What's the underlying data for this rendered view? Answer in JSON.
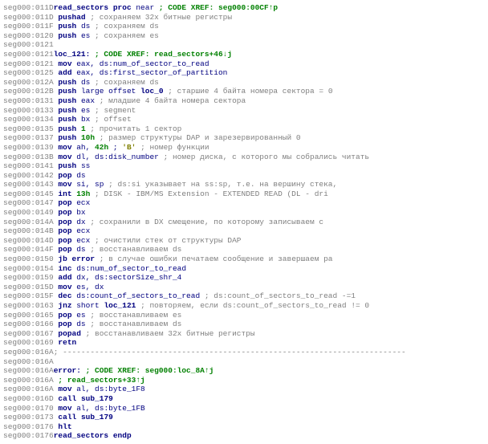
{
  "lines": [
    {
      "addr": "seg000:011D",
      "label": "read_sectors",
      "op1": "proc",
      "op2": "near",
      "xref": "; CODE XREF: seg000:00CF↑p"
    },
    {
      "addr": "seg000:011D",
      "mnemonic": "pushad",
      "comment": "; сохраняем 32x битные регистры"
    },
    {
      "addr": "seg000:011F",
      "mnemonic": "push",
      "args": "ds",
      "comment": "; сохраняем ds"
    },
    {
      "addr": "seg000:0120",
      "mnemonic": "push",
      "args": "es",
      "comment": "; сохраняем es"
    },
    {
      "addr": "seg000:0121"
    },
    {
      "addr": "seg000:0121",
      "label": "loc_121:",
      "xref": "; CODE XREF: read_sectors+46↓j"
    },
    {
      "addr": "seg000:0121",
      "mnemonic": "mov",
      "args": "eax, ds:num_of_sector_to_read"
    },
    {
      "addr": "seg000:0125",
      "mnemonic": "add",
      "args": "eax, ds:first_sector_of_partition"
    },
    {
      "addr": "seg000:012A",
      "mnemonic": "push",
      "args": "ds",
      "comment": "; сохраняем ds"
    },
    {
      "addr": "seg000:012B",
      "mnemonic": "push",
      "args_html": "large offset <span class='label'>loc_0</span>",
      "comment": " ; старшие 4 байта номера сектора = 0"
    },
    {
      "addr": "seg000:0131",
      "mnemonic": "push",
      "args": "eax",
      "comment": "; младшие 4 байта номера сектора"
    },
    {
      "addr": "seg000:0133",
      "mnemonic": "push",
      "args": "es",
      "comment": "; segment"
    },
    {
      "addr": "seg000:0134",
      "mnemonic": "push",
      "args": "bx",
      "comment": "; offset"
    },
    {
      "addr": "seg000:0135",
      "mnemonic": "push",
      "num": "1",
      "comment": "; прочитать 1 сектор"
    },
    {
      "addr": "seg000:0137",
      "mnemonic": "push",
      "numhex": "10h",
      "comment": "; размер структуры DAP и зарезервированный 0"
    },
    {
      "addr": "seg000:0139",
      "mnemonic": "mov",
      "args_html": "ah, <span class='numhex'>42h</span> ; <span class='char'>'B'</span>",
      "comment": "    ; номер функции"
    },
    {
      "addr": "seg000:013B",
      "mnemonic": "mov",
      "args": "dl, ds:disk_number",
      "comment": " ; номер диска, с которого мы собрались читать"
    },
    {
      "addr": "seg000:0141",
      "mnemonic": "push",
      "args": "ss"
    },
    {
      "addr": "seg000:0142",
      "mnemonic": "pop",
      "args": "ds"
    },
    {
      "addr": "seg000:0143",
      "mnemonic": "mov",
      "args": "si, sp",
      "comment": "; ds:si указывает на ss:sp, т.е. на вершину стека,"
    },
    {
      "addr": "seg000:0145",
      "mnemonic": "int",
      "numhex": "13h",
      "comment": "; DISK - IBM/MS Extension - EXTENDED READ (DL - dri"
    },
    {
      "addr": "seg000:0147",
      "mnemonic": "pop",
      "args": "ecx"
    },
    {
      "addr": "seg000:0149",
      "mnemonic": "pop",
      "args": "bx"
    },
    {
      "addr": "seg000:014A",
      "mnemonic": "pop",
      "args": "dx",
      "comment": "; сохранили в DX смещение, по которому записываем с"
    },
    {
      "addr": "seg000:014B",
      "mnemonic": "pop",
      "args": "ecx"
    },
    {
      "addr": "seg000:014D",
      "mnemonic": "pop",
      "args": "ecx",
      "comment": "; очистили стек от структуры DAP"
    },
    {
      "addr": "seg000:014F",
      "mnemonic": "pop",
      "args": "ds",
      "comment": "; восстанавливаем ds"
    },
    {
      "addr": "seg000:0150",
      "mnemonic": "jb",
      "args_html": "<span class='label'>error</span>",
      "comment": "; в случае ошибки печатаем сообщение и завершаем ра"
    },
    {
      "addr": "seg000:0154",
      "mnemonic": "inc",
      "args": "ds:num_of_sector_to_read"
    },
    {
      "addr": "seg000:0159",
      "mnemonic": "add",
      "args": "dx, ds:sectorSize_shr_4"
    },
    {
      "addr": "seg000:015D",
      "mnemonic": "mov",
      "args": "es, dx"
    },
    {
      "addr": "seg000:015F",
      "mnemonic": "dec",
      "args": "ds:count_of_sectors_to_read",
      "comment": " ; ds:count_of_sectors_to_read -=1"
    },
    {
      "addr": "seg000:0163",
      "mnemonic": "jnz",
      "args_html": "short <span class='label'>loc_121</span>",
      "comment": "; повторяем, если ds:count_of_sectors_to_read != 0"
    },
    {
      "addr": "seg000:0165",
      "mnemonic": "pop",
      "args": "es",
      "comment": "; восстанавливаем es"
    },
    {
      "addr": "seg000:0166",
      "mnemonic": "pop",
      "args": "ds",
      "comment": "; восстанавливаем ds"
    },
    {
      "addr": "seg000:0167",
      "mnemonic": "popad",
      "comment": "; восстанавливаем 32x битные регистры"
    },
    {
      "addr": "seg000:0169",
      "mnemonic": "retn"
    },
    {
      "addr": "seg000:016A",
      "dash": true
    },
    {
      "addr": "seg000:016A"
    },
    {
      "addr": "seg000:016A",
      "label": "error:",
      "xref": "; CODE XREF: seg000:loc_8A↑j"
    },
    {
      "addr": "seg000:016A",
      "xrefonly": "; read_sectors+33↑j"
    },
    {
      "addr": "seg000:016A",
      "mnemonic": "mov",
      "args": "al, ds:byte_1F8"
    },
    {
      "addr": "seg000:016D",
      "mnemonic": "call",
      "args_html": "<span class='label'>sub_179</span>"
    },
    {
      "addr": "seg000:0170",
      "mnemonic": "mov",
      "args": "al, ds:byte_1FB"
    },
    {
      "addr": "seg000:0173",
      "mnemonic": "call",
      "args_html": "<span class='label'>sub_179</span>"
    },
    {
      "addr": "seg000:0176",
      "mnemonic": "hlt"
    },
    {
      "addr": "seg000:0176",
      "label": "read_sectors",
      "op1": "endp"
    }
  ]
}
